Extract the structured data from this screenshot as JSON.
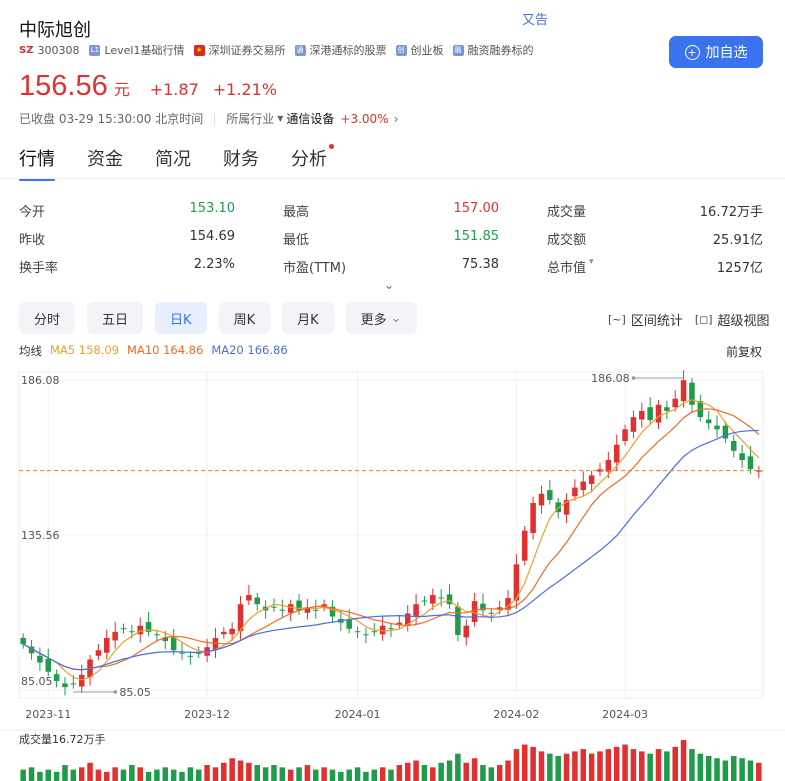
{
  "stock": {
    "name": "中际旭创",
    "market": "SZ",
    "code": "300308",
    "hidden_link": "又告",
    "tags": [
      {
        "icon": "L1",
        "label": "Level1基础行情",
        "icon_name": "level1-icon"
      },
      {
        "icon": "★",
        "label": "深圳证券交易所",
        "icon_name": "china-flag-icon"
      },
      {
        "icon": "通",
        "label": "深港通标的股票",
        "icon_name": "connect-icon"
      },
      {
        "icon": "创",
        "label": "创业板",
        "icon_name": "chinext-icon"
      },
      {
        "icon": "融",
        "label": "融资融券标的",
        "icon_name": "margin-icon"
      }
    ],
    "add_label": "加自选",
    "price": "156.56",
    "unit": "元",
    "change": "+1.87",
    "change_pct": "+1.21%",
    "status": "已收盘 03-29 15:30:00 北京时间",
    "industry_label": "所属行业",
    "industry": "通信设备",
    "industry_change": "+3.00%"
  },
  "tabs": [
    "行情",
    "资金",
    "简况",
    "财务",
    "分析"
  ],
  "stats": [
    [
      {
        "label": "今开",
        "value": "153.10",
        "cls": "down"
      },
      {
        "label": "最高",
        "value": "157.00",
        "cls": "up"
      },
      {
        "label": "成交量",
        "value": "16.72万手",
        "cls": "plain"
      }
    ],
    [
      {
        "label": "昨收",
        "value": "154.69",
        "cls": "plain"
      },
      {
        "label": "最低",
        "value": "151.85",
        "cls": "down"
      },
      {
        "label": "成交额",
        "value": "25.91亿",
        "cls": "plain"
      }
    ],
    [
      {
        "label": "换手率",
        "value": "2.23%",
        "cls": "plain"
      },
      {
        "label": "市盈(TTM)",
        "value": "75.38",
        "cls": "plain"
      },
      {
        "label": "总市值",
        "value": "1257亿",
        "cls": "plain",
        "dropdown": true
      }
    ]
  ],
  "periods": [
    "分时",
    "五日",
    "日K",
    "周K",
    "月K",
    "更多"
  ],
  "active_period": 2,
  "tools": [
    {
      "icon": "[~]",
      "label": "区间统计"
    },
    {
      "icon": "[◻]",
      "label": "超级视图"
    }
  ],
  "ma": {
    "title": "均线",
    "items": [
      {
        "label": "MA5 158.09",
        "color": "#f0a02a"
      },
      {
        "label": "MA10 164.86",
        "color": "#f06a2a"
      },
      {
        "label": "MA20 166.86",
        "color": "#4a6fdc"
      }
    ],
    "adjust": "前复权"
  },
  "colors": {
    "up": "#e0302f",
    "down": "#1f9c4a",
    "accent": "#3a73f0"
  },
  "chart_data": {
    "type": "candlestick",
    "y_ticks": [
      "186.08",
      "135.56",
      "85.05"
    ],
    "ylim": [
      85.05,
      186.08
    ],
    "x_ticks": [
      {
        "label": "2023-11",
        "index": 3
      },
      {
        "label": "2023-12",
        "index": 22
      },
      {
        "label": "2024-01",
        "index": 40
      },
      {
        "label": "2024-02",
        "index": 59
      },
      {
        "label": "2024-03",
        "index": 72
      }
    ],
    "max_label": "186.08",
    "max_index": 79,
    "min_label": "85.05",
    "min_index": 6,
    "last_price": 156.56,
    "volume_label": "成交量16.72万手",
    "closes": [
      100,
      97,
      94,
      91,
      88,
      86,
      87,
      90,
      95,
      98,
      102,
      104,
      105,
      104,
      106,
      104,
      103,
      101,
      98,
      97,
      96,
      97,
      99,
      102,
      104,
      105,
      113,
      116,
      113,
      111,
      112,
      111,
      113,
      111,
      112,
      111,
      113,
      109,
      107,
      105,
      104,
      103,
      104,
      106,
      105,
      107,
      110,
      113,
      114,
      116,
      115,
      113,
      103,
      106,
      114,
      111,
      110,
      112,
      115,
      126,
      137,
      146,
      149,
      147,
      143,
      147,
      151,
      153,
      155,
      157,
      160,
      165,
      170,
      174,
      176,
      173,
      178,
      176,
      180,
      186,
      178,
      174,
      172,
      170,
      167,
      163,
      160,
      157,
      156.56
    ],
    "volumes": [
      5,
      6,
      4,
      5,
      4,
      7,
      5,
      6,
      8,
      5,
      4,
      6,
      5,
      7,
      6,
      4,
      5,
      6,
      5,
      4,
      6,
      5,
      7,
      6,
      8,
      10,
      9,
      8,
      7,
      6,
      7,
      6,
      5,
      6,
      7,
      5,
      6,
      5,
      4,
      5,
      6,
      4,
      5,
      6,
      5,
      7,
      8,
      9,
      7,
      6,
      8,
      9,
      12,
      8,
      10,
      7,
      6,
      7,
      9,
      14,
      16,
      15,
      13,
      12,
      11,
      12,
      13,
      14,
      12,
      13,
      14,
      15,
      16,
      14,
      13,
      12,
      14,
      13,
      15,
      18,
      14,
      12,
      11,
      10,
      9,
      11,
      10,
      9,
      8
    ]
  }
}
